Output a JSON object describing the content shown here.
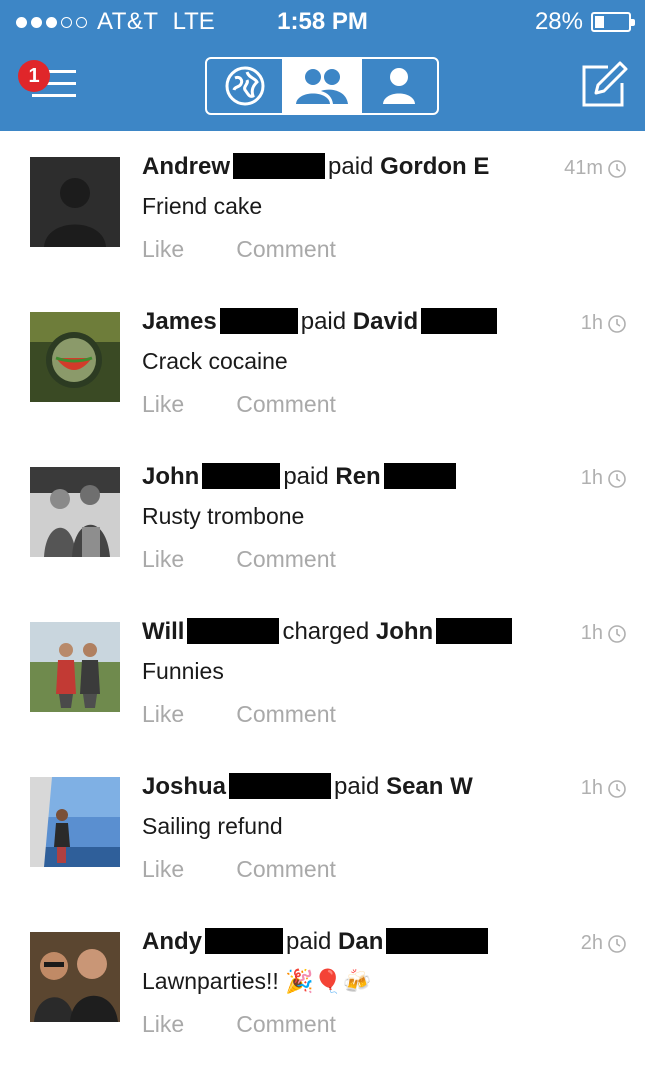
{
  "status_bar": {
    "carrier": "AT&T",
    "network": "LTE",
    "time": "1:58 PM",
    "battery": "28%"
  },
  "header": {
    "notification_count": "1"
  },
  "feed": [
    {
      "actor": "Andrew",
      "verb": "paid",
      "target": "Gordon E",
      "time": "41m",
      "note": "Friend cake",
      "like": "Like",
      "comment": "Comment"
    },
    {
      "actor": "James",
      "verb": "paid",
      "target": "David",
      "time": "1h",
      "note": "Crack cocaine",
      "like": "Like",
      "comment": "Comment"
    },
    {
      "actor": "John",
      "verb": "paid",
      "target": "Ren",
      "time": "1h",
      "note": "Rusty trombone",
      "like": "Like",
      "comment": "Comment"
    },
    {
      "actor": "Will",
      "verb": "charged",
      "target": "John",
      "time": "1h",
      "note": "Funnies",
      "like": "Like",
      "comment": "Comment"
    },
    {
      "actor": "Joshua",
      "verb": "paid",
      "target": "Sean W",
      "time": "1h",
      "note": "Sailing refund",
      "like": "Like",
      "comment": "Comment"
    },
    {
      "actor": "Andy",
      "verb": "paid",
      "target": "Dan",
      "time": "2h",
      "note": "Lawnparties!! 🎉🎈🍻",
      "like": "Like",
      "comment": "Comment"
    }
  ],
  "colors": {
    "header_blue": "#3d86c6",
    "badge_red": "#e0262a",
    "muted_gray": "#a9a9a9"
  },
  "icons": {
    "menu": "hamburger-icon",
    "segments": [
      "globe-icon",
      "friends-icon",
      "person-icon"
    ],
    "compose": "compose-icon",
    "time": "clock-icon"
  }
}
